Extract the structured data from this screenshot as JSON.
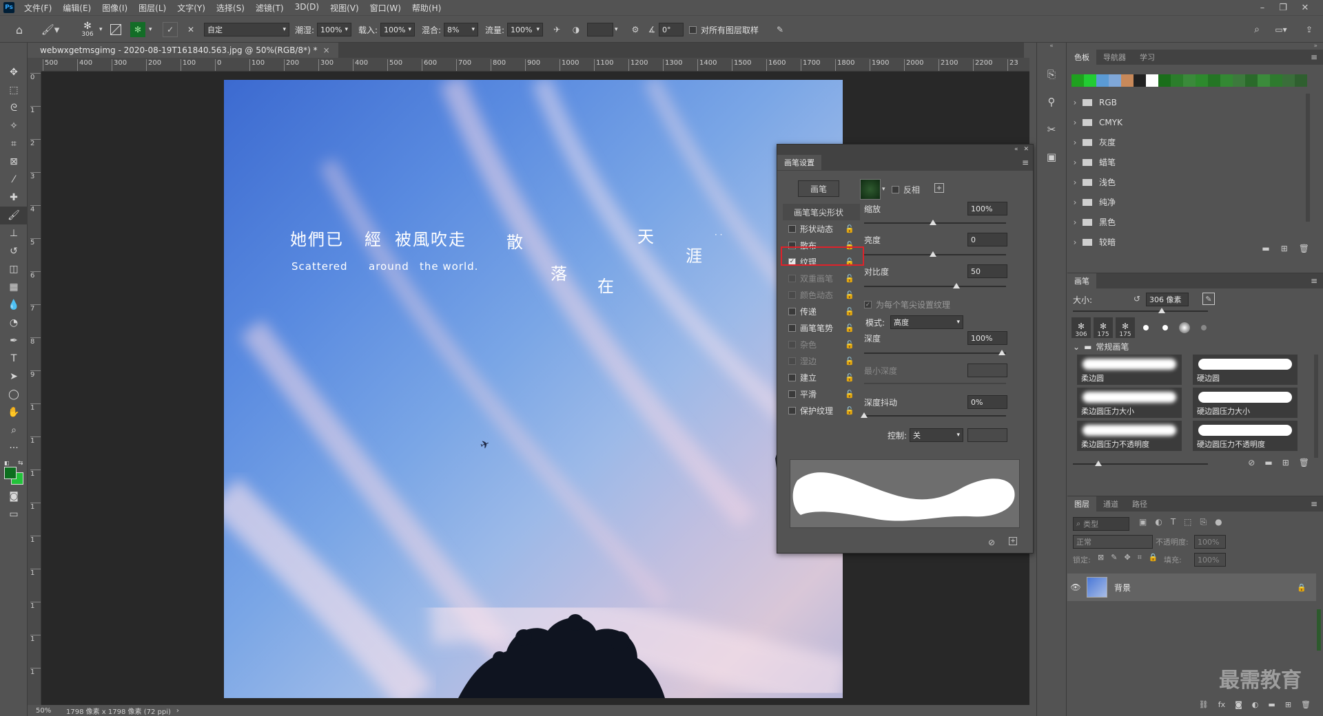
{
  "app": {
    "logo": "Ps"
  },
  "menu": [
    "文件(F)",
    "编辑(E)",
    "图像(I)",
    "图层(L)",
    "文字(Y)",
    "选择(S)",
    "滤镜(T)",
    "3D(D)",
    "视图(V)",
    "窗口(W)",
    "帮助(H)"
  ],
  "options": {
    "brush_size": "306",
    "preset": "自定",
    "wet_label": "潮湿:",
    "wet_value": "100%",
    "load_label": "载入:",
    "load_value": "100%",
    "mix_label": "混合:",
    "mix_value": "8%",
    "flow_label": "流量:",
    "flow_value": "100%",
    "angle_value": "0°",
    "sample_all_label": "对所有图层取样"
  },
  "document": {
    "tab_title": "webwxgetmsgimg - 2020-08-19T161840.563.jpg @ 50%(RGB/8*) *",
    "zoom": "50%",
    "size_info": "1798 像素 x 1798 像素 (72 ppi)",
    "ruler_h": [
      "500",
      "400",
      "300",
      "200",
      "100",
      "0",
      "100",
      "200",
      "300",
      "400",
      "500",
      "600",
      "700",
      "800",
      "900",
      "1000",
      "1100",
      "1200",
      "1300",
      "1400",
      "1500",
      "1600",
      "1700",
      "1800",
      "1900",
      "2000",
      "2100",
      "2200",
      "23"
    ],
    "ruler_v": [
      "0",
      "1",
      "2",
      "3",
      "4",
      "5",
      "6",
      "7",
      "8",
      "9",
      "1",
      "1",
      "1",
      "1",
      "1",
      "1",
      "1",
      "1",
      "1"
    ]
  },
  "photo_text": {
    "line1_a": "她們已",
    "line1_b": "經",
    "line1_c": "被風吹走",
    "en_a": "Scattered",
    "en_b": "around",
    "en_c": "the world.",
    "san": "散",
    "luo": "落",
    "zai": "在",
    "tian": "天",
    "ya": "涯",
    "dots": "· ·"
  },
  "brush_settings": {
    "title": "画笔设置",
    "brush_button": "画笔",
    "tip_shape": "画笔笔尖形状",
    "invert_label": "反相",
    "options": [
      {
        "label": "形状动态",
        "checked": false,
        "enabled": true
      },
      {
        "label": "散布",
        "checked": false,
        "enabled": true
      },
      {
        "label": "纹理",
        "checked": true,
        "enabled": true
      },
      {
        "label": "双重画笔",
        "checked": false,
        "enabled": false
      },
      {
        "label": "颜色动态",
        "checked": false,
        "enabled": false
      },
      {
        "label": "传递",
        "checked": false,
        "enabled": true
      },
      {
        "label": "画笔笔势",
        "checked": false,
        "enabled": true
      },
      {
        "label": "杂色",
        "checked": false,
        "enabled": false
      },
      {
        "label": "湿边",
        "checked": false,
        "enabled": false
      },
      {
        "label": "建立",
        "checked": false,
        "enabled": true
      },
      {
        "label": "平滑",
        "checked": false,
        "enabled": true
      },
      {
        "label": "保护纹理",
        "checked": false,
        "enabled": true
      }
    ],
    "scale_label": "缩放",
    "scale_value": "100%",
    "scale_pos": 0.5,
    "brightness_label": "亮度",
    "brightness_value": "0",
    "brightness_pos": 0.5,
    "contrast_label": "对比度",
    "contrast_value": "50",
    "contrast_pos": 0.67,
    "each_tip_label": "为每个笔尖设置纹理",
    "mode_label": "模式:",
    "mode_value": "高度",
    "depth_label": "深度",
    "depth_value": "100%",
    "depth_pos": 1.0,
    "min_depth_label": "最小深度",
    "jitter_label": "深度抖动",
    "jitter_value": "0%",
    "jitter_pos": 0.0,
    "control_label": "控制:",
    "control_value": "关"
  },
  "swatches_panel": {
    "tabs": [
      "色板",
      "导航器",
      "学习"
    ],
    "colors": [
      "#1fa11f",
      "#22cc33",
      "#5b9bd5",
      "#7fa7d8",
      "#c8895a",
      "#222222",
      "#ffffff",
      "#1a6e1a",
      "#2b7d2b",
      "#3a8a3a",
      "#2d8a2d",
      "#247524",
      "#338833",
      "#3c7a3c",
      "#2a6a2a",
      "#3b8b3b",
      "#2e7a2e",
      "#3a6e3a",
      "#2f5f2f"
    ],
    "folders": [
      "RGB",
      "CMYK",
      "灰度",
      "蜡笔",
      "浅色",
      "纯净",
      "黑色",
      "较暗"
    ]
  },
  "brushes_panel": {
    "title": "画笔",
    "size_label": "大小:",
    "size_value": "306 像素",
    "thumbs": [
      "306",
      "175",
      "175"
    ],
    "group": "常规画笔",
    "brushes": [
      "柔边圆",
      "硬边圆",
      "柔边圆压力大小",
      "硬边圆压力大小",
      "柔边圆压力不透明度",
      "硬边圆压力不透明度"
    ]
  },
  "layers_panel": {
    "tabs": [
      "图层",
      "通道",
      "路径"
    ],
    "kind_placeholder": "类型",
    "blend_mode": "正常",
    "opacity_label": "不透明度:",
    "opacity_value": "100%",
    "lock_label": "锁定:",
    "fill_label": "填充:",
    "fill_value": "100%",
    "layers": [
      {
        "name": "背景",
        "visible": true,
        "locked": true
      }
    ]
  },
  "watermark": "最需教育"
}
